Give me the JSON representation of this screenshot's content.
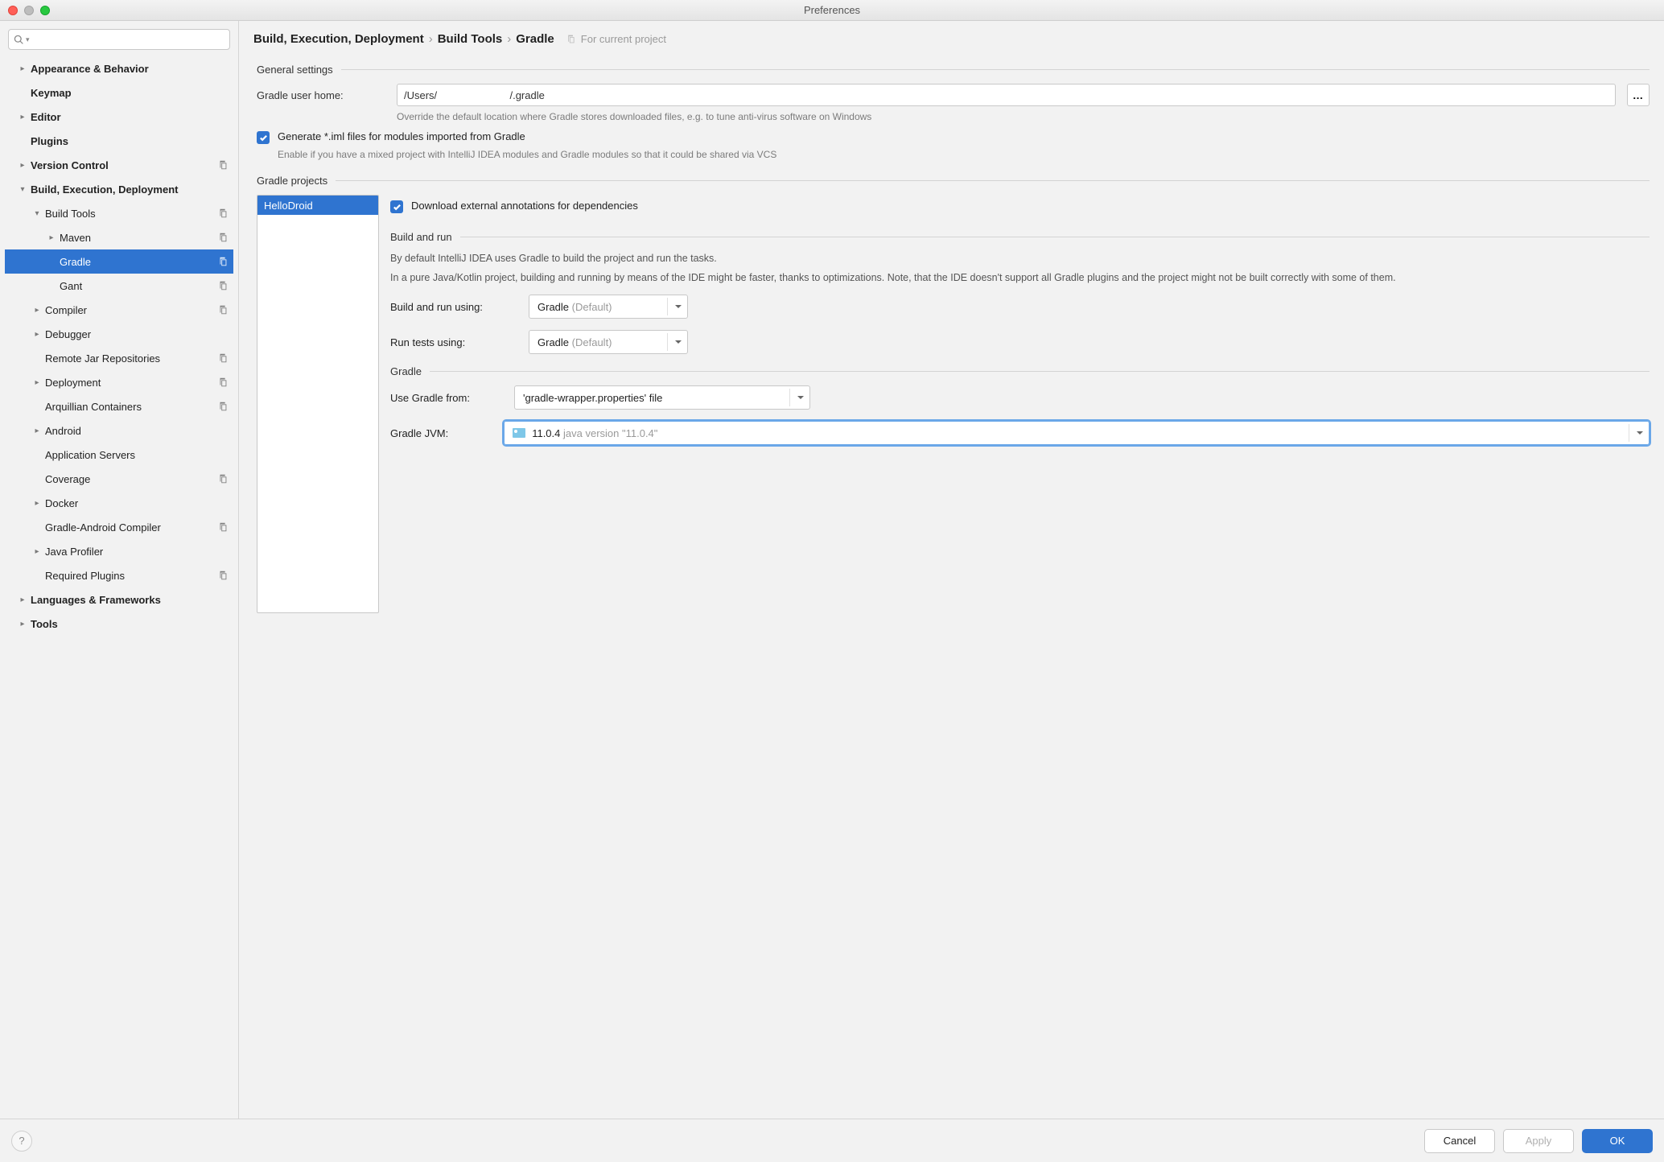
{
  "window": {
    "title": "Preferences"
  },
  "search": {
    "placeholder": ""
  },
  "tree": {
    "items": [
      {
        "label": "Appearance & Behavior",
        "bold": true,
        "expandable": true,
        "open": false,
        "indent": 1
      },
      {
        "label": "Keymap",
        "bold": true,
        "expandable": false,
        "indent": 1,
        "pad": true
      },
      {
        "label": "Editor",
        "bold": true,
        "expandable": true,
        "open": false,
        "indent": 1
      },
      {
        "label": "Plugins",
        "bold": true,
        "expandable": false,
        "indent": 1,
        "pad": true
      },
      {
        "label": "Version Control",
        "bold": true,
        "expandable": true,
        "open": false,
        "indent": 1,
        "trail": true
      },
      {
        "label": "Build, Execution, Deployment",
        "bold": true,
        "expandable": true,
        "open": true,
        "indent": 1
      },
      {
        "label": "Build Tools",
        "expandable": true,
        "open": true,
        "indent": 2,
        "trail": true
      },
      {
        "label": "Maven",
        "expandable": true,
        "open": false,
        "indent": 3,
        "trail": true
      },
      {
        "label": "Gradle",
        "expandable": false,
        "indent": 3,
        "selected": true,
        "trail": true,
        "pad": true
      },
      {
        "label": "Gant",
        "expandable": false,
        "indent": 3,
        "trail": true,
        "pad": true
      },
      {
        "label": "Compiler",
        "expandable": true,
        "open": false,
        "indent": 2,
        "trail": true
      },
      {
        "label": "Debugger",
        "expandable": true,
        "open": false,
        "indent": 2
      },
      {
        "label": "Remote Jar Repositories",
        "expandable": false,
        "indent": 2,
        "trail": true,
        "pad": true
      },
      {
        "label": "Deployment",
        "expandable": true,
        "open": false,
        "indent": 2,
        "trail": true
      },
      {
        "label": "Arquillian Containers",
        "expandable": false,
        "indent": 2,
        "trail": true,
        "pad": true
      },
      {
        "label": "Android",
        "expandable": true,
        "open": false,
        "indent": 2
      },
      {
        "label": "Application Servers",
        "expandable": false,
        "indent": 2,
        "pad": true
      },
      {
        "label": "Coverage",
        "expandable": false,
        "indent": 2,
        "trail": true,
        "pad": true
      },
      {
        "label": "Docker",
        "expandable": true,
        "open": false,
        "indent": 2
      },
      {
        "label": "Gradle-Android Compiler",
        "expandable": false,
        "indent": 2,
        "trail": true,
        "pad": true
      },
      {
        "label": "Java Profiler",
        "expandable": true,
        "open": false,
        "indent": 2
      },
      {
        "label": "Required Plugins",
        "expandable": false,
        "indent": 2,
        "trail": true,
        "pad": true
      },
      {
        "label": "Languages & Frameworks",
        "bold": true,
        "expandable": true,
        "open": false,
        "indent": 1
      },
      {
        "label": "Tools",
        "bold": true,
        "expandable": true,
        "open": false,
        "indent": 1
      }
    ]
  },
  "breadcrumb": {
    "parts": [
      "Build, Execution, Deployment",
      "Build Tools",
      "Gradle"
    ],
    "scope": "For current project"
  },
  "general": {
    "title": "General settings",
    "home_label": "Gradle user home:",
    "home_value": "/Users/                         /.gradle",
    "home_hint": "Override the default location where Gradle stores downloaded files, e.g. to tune anti-virus software on Windows",
    "iml_label": "Generate *.iml files for modules imported from Gradle",
    "iml_hint": "Enable if you have a mixed project with IntelliJ IDEA modules and Gradle modules so that it could be shared via VCS",
    "iml_checked": true
  },
  "projects": {
    "title": "Gradle projects",
    "items": [
      "HelloDroid"
    ],
    "download_label": "Download external annotations for dependencies",
    "download_checked": true,
    "build_run": {
      "title": "Build and run",
      "desc1": "By default IntelliJ IDEA uses Gradle to build the project and run the tasks.",
      "desc2": "In a pure Java/Kotlin project, building and running by means of the IDE might be faster, thanks to optimizations. Note, that the IDE doesn't support all Gradle plugins and the project might not be built correctly with some of them.",
      "build_label": "Build and run using:",
      "build_value": "Gradle",
      "build_suffix": "(Default)",
      "tests_label": "Run tests using:",
      "tests_value": "Gradle",
      "tests_suffix": "(Default)"
    },
    "gradle": {
      "title": "Gradle",
      "from_label": "Use Gradle from:",
      "from_value": "'gradle-wrapper.properties' file",
      "jvm_label": "Gradle JVM:",
      "jvm_value": "11.0.4",
      "jvm_suffix": "java version \"11.0.4\""
    }
  },
  "footer": {
    "cancel": "Cancel",
    "apply": "Apply",
    "ok": "OK"
  }
}
